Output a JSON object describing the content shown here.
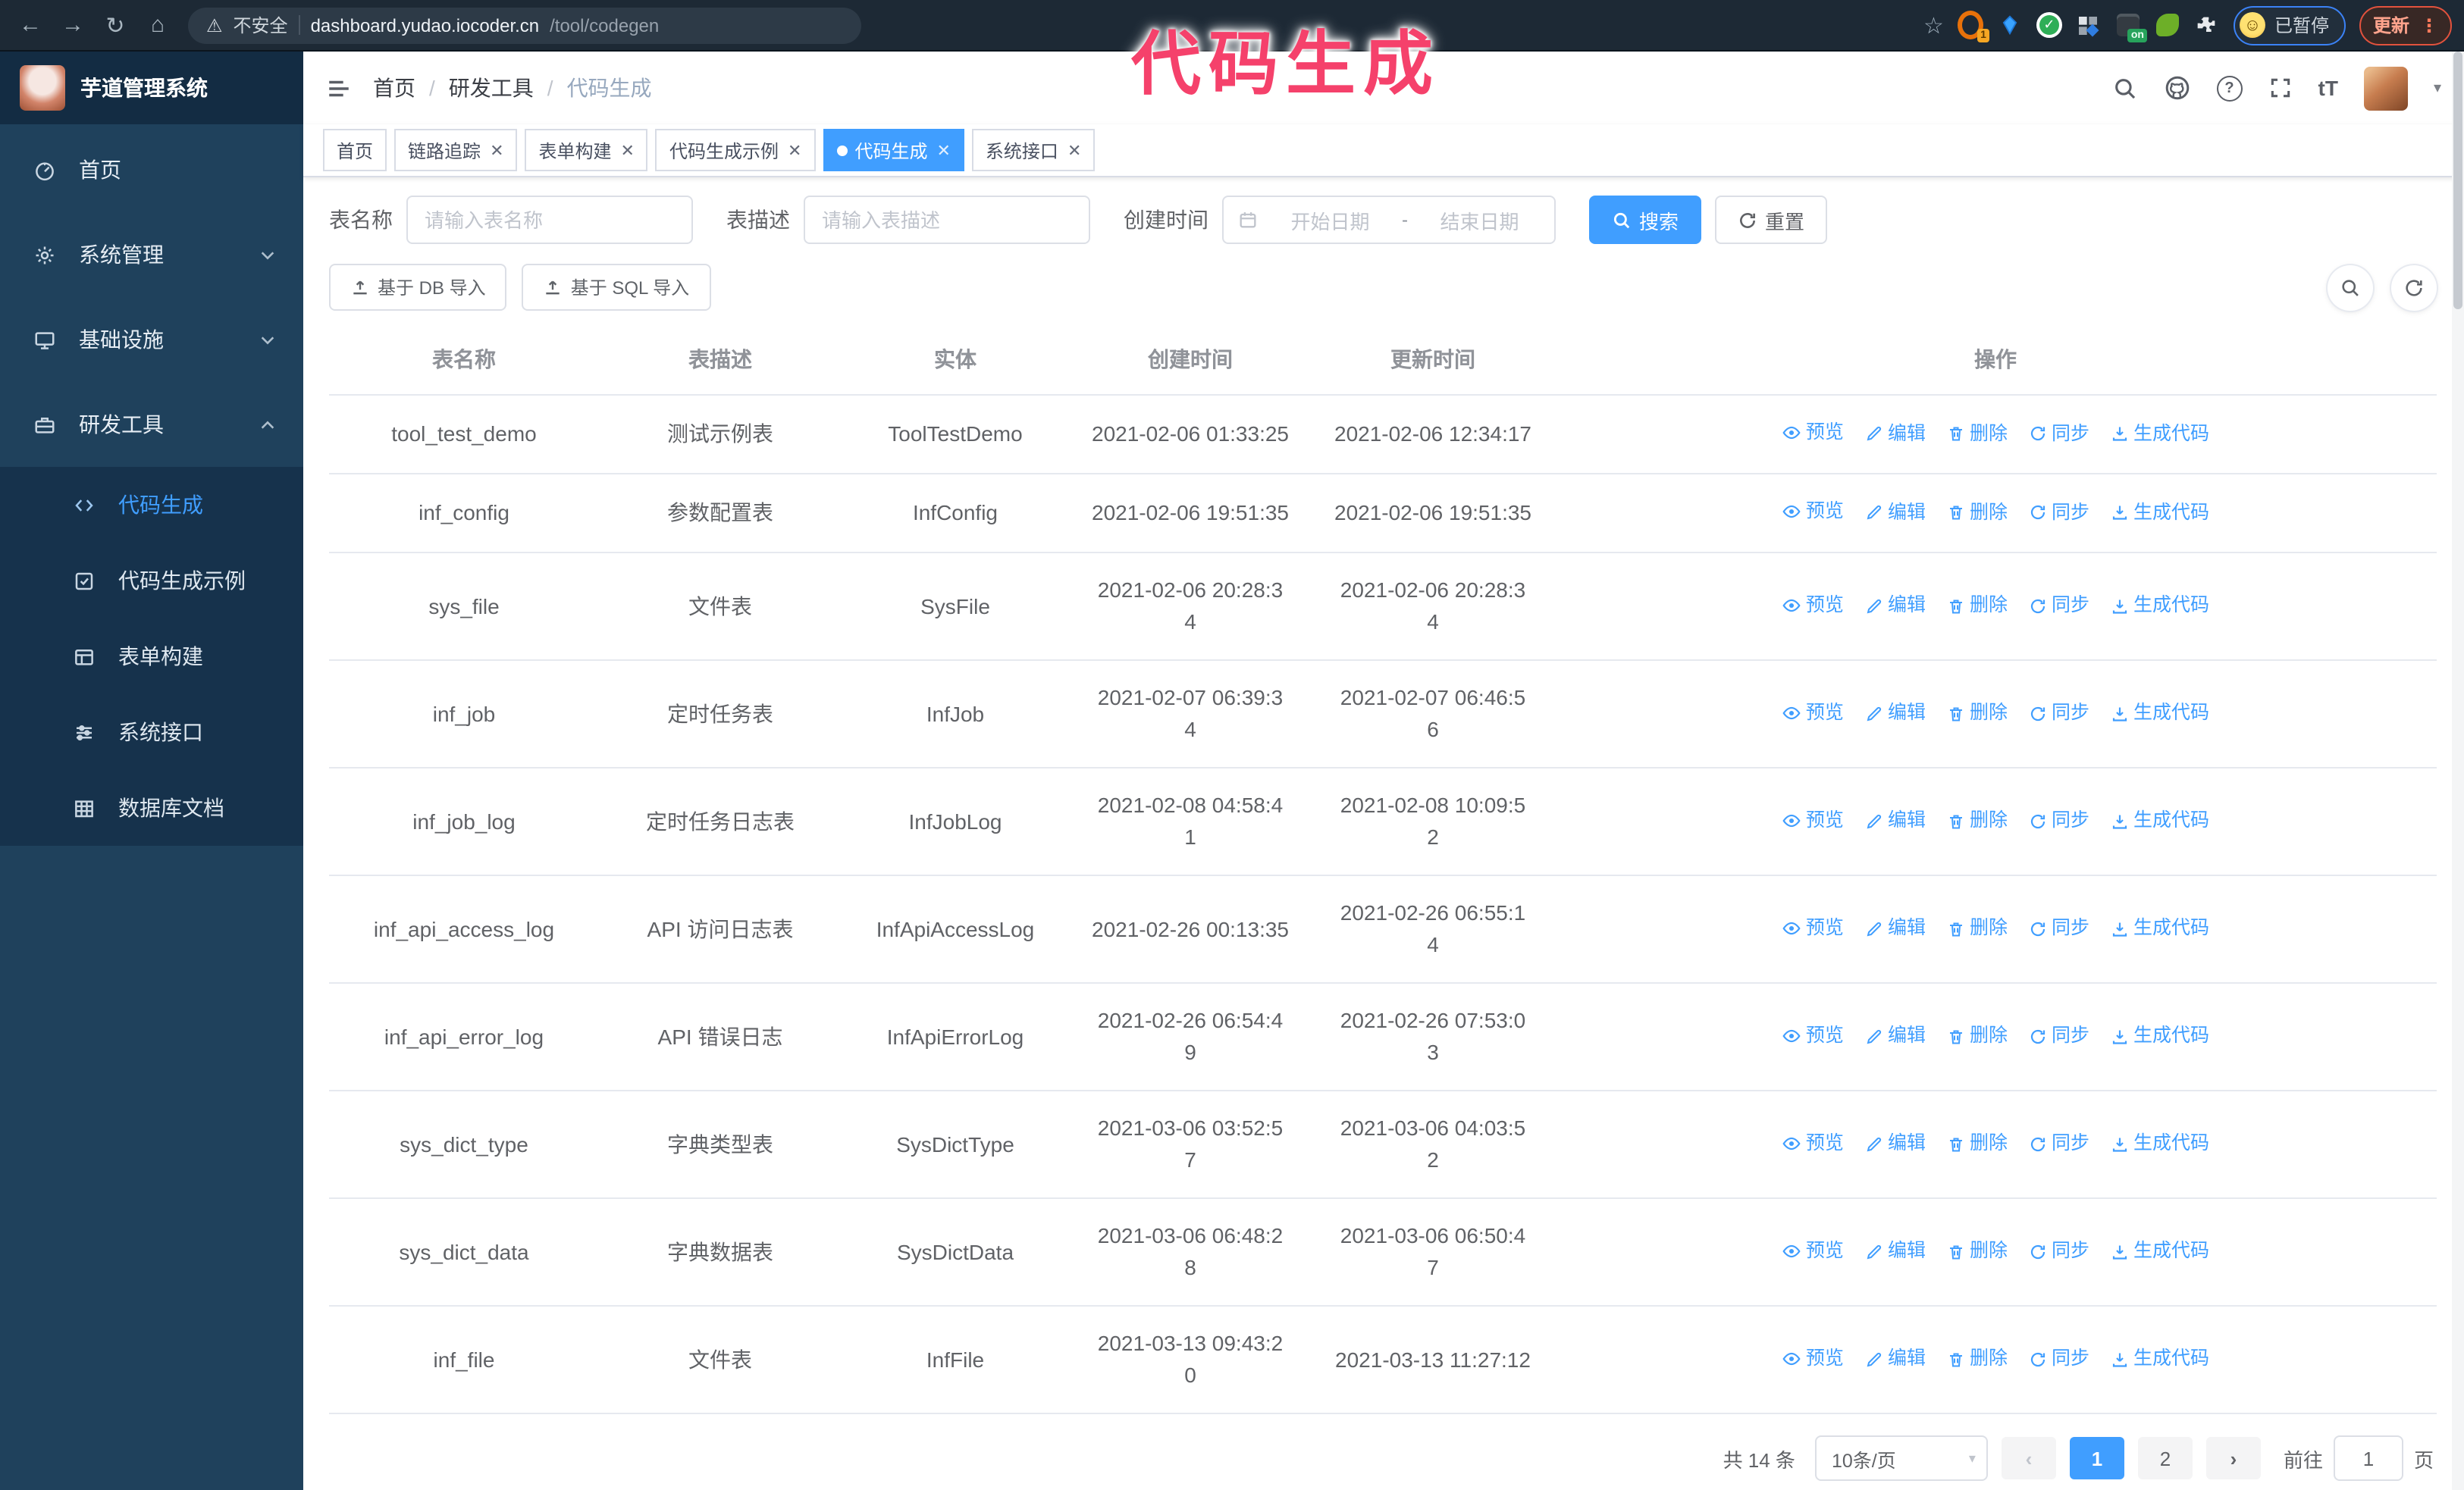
{
  "browser": {
    "security_label": "不安全",
    "url_host": "dashboard.yudao.iocoder.cn",
    "url_path": "/tool/codegen",
    "paused_badge": "已暂停",
    "update_button": "更新",
    "extensions": [
      {
        "name": "orange-extension",
        "badge": "1"
      },
      {
        "name": "gem-extension",
        "badge": ""
      },
      {
        "name": "check-extension",
        "badge": ""
      },
      {
        "name": "grid-extension",
        "badge": ""
      },
      {
        "name": "dark-extension",
        "badge": "on"
      },
      {
        "name": "key-extension",
        "badge": ""
      },
      {
        "name": "puzzle-extensions-menu",
        "badge": ""
      }
    ]
  },
  "annotation": {
    "text": "代码生成",
    "color": "#f5416b"
  },
  "colors": {
    "accent": "#409eff",
    "sidebar_bg": "#1f415c",
    "submenu_bg": "#16324c",
    "chrome_bg": "#1d2935"
  },
  "app": {
    "title": "芋道管理系统",
    "breadcrumb": [
      "首页",
      "研发工具",
      "代码生成"
    ],
    "tabs": [
      {
        "label": "首页",
        "closable": false,
        "active": false
      },
      {
        "label": "链路追踪",
        "closable": true,
        "active": false
      },
      {
        "label": "表单构建",
        "closable": true,
        "active": false
      },
      {
        "label": "代码生成示例",
        "closable": true,
        "active": false
      },
      {
        "label": "代码生成",
        "closable": true,
        "active": true
      },
      {
        "label": "系统接口",
        "closable": true,
        "active": false
      }
    ],
    "sidebar": [
      {
        "label": "首页",
        "icon": "dashboard",
        "expandable": false
      },
      {
        "label": "系统管理",
        "icon": "gear",
        "expandable": true,
        "expanded": false
      },
      {
        "label": "基础设施",
        "icon": "monitor",
        "expandable": true,
        "expanded": false
      },
      {
        "label": "研发工具",
        "icon": "toolbox",
        "expandable": true,
        "expanded": true,
        "children": [
          {
            "label": "代码生成",
            "icon": "code",
            "active": true
          },
          {
            "label": "代码生成示例",
            "icon": "example",
            "active": false
          },
          {
            "label": "表单构建",
            "icon": "form",
            "active": false
          },
          {
            "label": "系统接口",
            "icon": "api",
            "active": false
          },
          {
            "label": "数据库文档",
            "icon": "database",
            "active": false
          }
        ]
      }
    ]
  },
  "search": {
    "fields": [
      {
        "label": "表名称",
        "placeholder": "请输入表名称"
      },
      {
        "label": "表描述",
        "placeholder": "请输入表描述"
      },
      {
        "label": "创建时间",
        "start": "开始日期",
        "separator": "-",
        "end": "结束日期"
      }
    ],
    "search_label": "搜索",
    "reset_label": "重置"
  },
  "toolbar": {
    "import_db": "基于 DB 导入",
    "import_sql": "基于 SQL 导入"
  },
  "table": {
    "columns": [
      "表名称",
      "表描述",
      "实体",
      "创建时间",
      "更新时间",
      "操作"
    ],
    "actions": [
      {
        "label": "预览",
        "icon": "eye"
      },
      {
        "label": "编辑",
        "icon": "edit"
      },
      {
        "label": "删除",
        "icon": "trash"
      },
      {
        "label": "同步",
        "icon": "sync"
      },
      {
        "label": "生成代码",
        "icon": "download"
      }
    ],
    "rows": [
      {
        "name": "tool_test_demo",
        "desc": "测试示例表",
        "entity": "ToolTestDemo",
        "created": "2021-02-06 01:33:25",
        "updated": "2021-02-06 12:34:17"
      },
      {
        "name": "inf_config",
        "desc": "参数配置表",
        "entity": "InfConfig",
        "created": "2021-02-06 19:51:35",
        "updated": "2021-02-06 19:51:35"
      },
      {
        "name": "sys_file",
        "desc": "文件表",
        "entity": "SysFile",
        "created": "2021-02-06 20:28:3\n4",
        "updated": "2021-02-06 20:28:3\n4"
      },
      {
        "name": "inf_job",
        "desc": "定时任务表",
        "entity": "InfJob",
        "created": "2021-02-07 06:39:3\n4",
        "updated": "2021-02-07 06:46:5\n6"
      },
      {
        "name": "inf_job_log",
        "desc": "定时任务日志表",
        "entity": "InfJobLog",
        "created": "2021-02-08 04:58:4\n1",
        "updated": "2021-02-08 10:09:5\n2"
      },
      {
        "name": "inf_api_access_log",
        "desc": "API 访问日志表",
        "entity": "InfApiAccessLog",
        "created": "2021-02-26 00:13:35",
        "updated": "2021-02-26 06:55:1\n4"
      },
      {
        "name": "inf_api_error_log",
        "desc": "API 错误日志",
        "entity": "InfApiErrorLog",
        "created": "2021-02-26 06:54:4\n9",
        "updated": "2021-02-26 07:53:0\n3"
      },
      {
        "name": "sys_dict_type",
        "desc": "字典类型表",
        "entity": "SysDictType",
        "created": "2021-03-06 03:52:5\n7",
        "updated": "2021-03-06 04:03:5\n2"
      },
      {
        "name": "sys_dict_data",
        "desc": "字典数据表",
        "entity": "SysDictData",
        "created": "2021-03-06 06:48:2\n8",
        "updated": "2021-03-06 06:50:4\n7"
      },
      {
        "name": "inf_file",
        "desc": "文件表",
        "entity": "InfFile",
        "created": "2021-03-13 09:43:2\n0",
        "updated": "2021-03-13 11:27:12"
      }
    ]
  },
  "pagination": {
    "total": "共 14 条",
    "page_size": "10条/页",
    "pages": [
      "1",
      "2"
    ],
    "active_page": "1",
    "goto_label": "前往",
    "goto_value": "1",
    "goto_suffix": "页"
  }
}
